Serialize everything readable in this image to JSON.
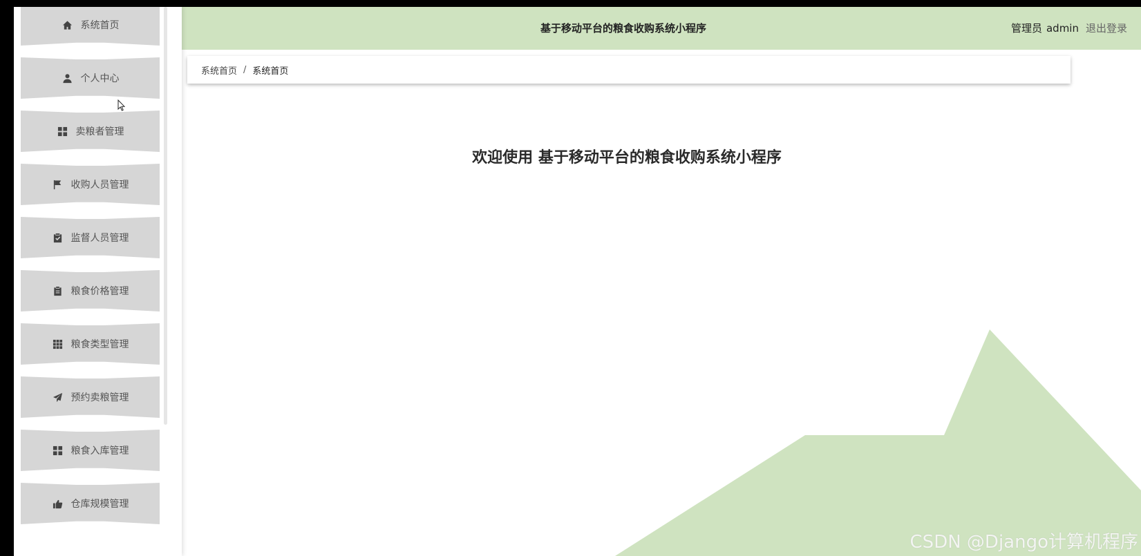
{
  "header": {
    "title": "基于移动平台的粮食收购系统小程序",
    "role": "管理员",
    "username": "admin",
    "logout_label": "退出登录"
  },
  "sidebar": {
    "items": [
      {
        "label": "系统首页",
        "icon": "home-icon"
      },
      {
        "label": "个人中心",
        "icon": "user-icon"
      },
      {
        "label": "卖粮者管理",
        "icon": "grid-icon"
      },
      {
        "label": "收购人员管理",
        "icon": "flag-icon"
      },
      {
        "label": "监督人员管理",
        "icon": "clipboard-check-icon"
      },
      {
        "label": "粮食价格管理",
        "icon": "clipboard-icon"
      },
      {
        "label": "粮食类型管理",
        "icon": "grid-9-icon"
      },
      {
        "label": "预约卖粮管理",
        "icon": "paper-plane-icon"
      },
      {
        "label": "粮食入库管理",
        "icon": "grid-icon"
      },
      {
        "label": "仓库规模管理",
        "icon": "thumbs-up-icon"
      }
    ]
  },
  "breadcrumb": {
    "root": "系统首页",
    "separator": "/",
    "current": "系统首页"
  },
  "main": {
    "welcome_text": "欢迎使用 基于移动平台的粮食收购系统小程序"
  },
  "watermark": "CSDN @Django计算机程序",
  "colors": {
    "header_bg": "#cfe3c0",
    "menu_item_bg": "#d6d6d6",
    "deco_green": "#cfe3c0"
  }
}
